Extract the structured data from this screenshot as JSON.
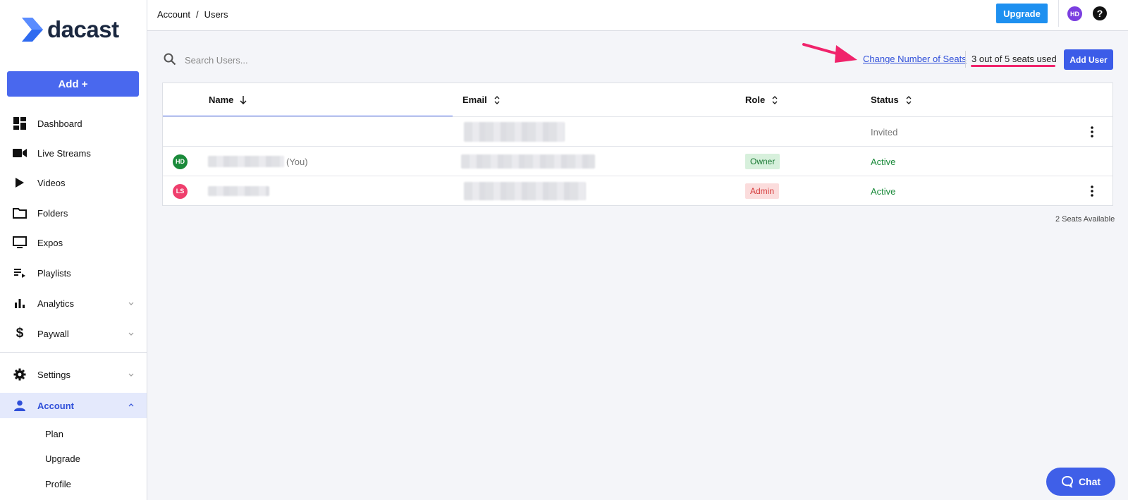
{
  "brand": {
    "name": "dacast",
    "accent": "#4968ee"
  },
  "sidebar": {
    "add_label": "Add +",
    "items": [
      {
        "label": "Dashboard",
        "icon": "dashboard-icon"
      },
      {
        "label": "Live Streams",
        "icon": "video-camera-icon"
      },
      {
        "label": "Videos",
        "icon": "play-icon"
      },
      {
        "label": "Folders",
        "icon": "folder-icon"
      },
      {
        "label": "Expos",
        "icon": "monitor-icon"
      },
      {
        "label": "Playlists",
        "icon": "playlist-icon"
      },
      {
        "label": "Analytics",
        "icon": "bar-chart-icon"
      },
      {
        "label": "Paywall",
        "icon": "dollar-icon"
      },
      {
        "label": "Settings",
        "icon": "gear-icon"
      },
      {
        "label": "Account",
        "icon": "person-icon"
      }
    ],
    "account_sub": [
      "Plan",
      "Upgrade",
      "Profile"
    ]
  },
  "header": {
    "breadcrumb": [
      "Account",
      "Users"
    ],
    "breadcrumb_sep": "/",
    "upgrade_label": "Upgrade",
    "avatar_initials": "HD",
    "help_label": "?"
  },
  "toolbar": {
    "search_placeholder": "Search Users...",
    "change_seats_label": "Change Number of Seats",
    "seats_used": "3 out of 5 seats used",
    "add_user_label": "Add User"
  },
  "table": {
    "columns": [
      "Name",
      "Email",
      "Role",
      "Status"
    ],
    "rows": [
      {
        "initials": "",
        "name_suffix": "",
        "role": "",
        "status": "Invited"
      },
      {
        "initials": "HD",
        "name_suffix": "(You)",
        "role": "Owner",
        "status": "Active"
      },
      {
        "initials": "LS",
        "name_suffix": "",
        "role": "Admin",
        "status": "Active"
      }
    ]
  },
  "footer": {
    "seats_available": "2 Seats Available"
  },
  "chat": {
    "label": "Chat"
  }
}
